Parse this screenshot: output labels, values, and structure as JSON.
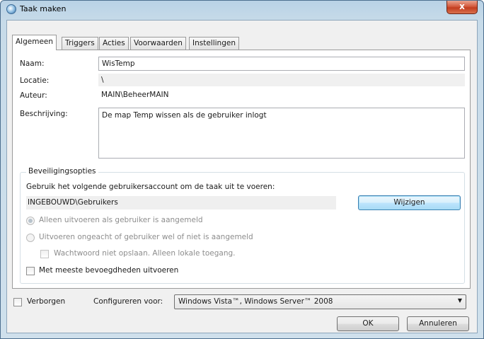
{
  "window": {
    "title": "Taak maken",
    "close_label": "x"
  },
  "tabs": [
    {
      "label": "Algemeen"
    },
    {
      "label": "Triggers"
    },
    {
      "label": "Acties"
    },
    {
      "label": "Voorwaarden"
    },
    {
      "label": "Instellingen"
    }
  ],
  "general": {
    "name_label": "Naam:",
    "name_value": "WisTemp",
    "location_label": "Locatie:",
    "location_value": "\\",
    "author_label": "Auteur:",
    "author_value": "MAIN\\BeheerMAIN",
    "description_label": "Beschrijving:",
    "description_value": "De map Temp wissen als de gebruiker inlogt"
  },
  "security": {
    "group_title": "Beveiligingsopties",
    "account_prompt": "Gebruik het volgende gebruikersaccount om de taak uit te voeren:",
    "account_value": "INGEBOUWD\\Gebruikers",
    "change_button": "Wijzigen",
    "radio_logged_on": "Alleen uitvoeren als gebruiker is aangemeld",
    "radio_whether": "Uitvoeren ongeacht of gebruiker wel of niet is aangemeld",
    "no_store_password": "Wachtwoord niet opslaan. Alleen lokale toegang.",
    "highest_privileges": "Met meeste bevoegdheden uitvoeren"
  },
  "footer": {
    "hidden_label": "Verborgen",
    "configure_label": "Configureren voor:",
    "configure_value": "Windows Vista™, Windows Server™ 2008",
    "ok_button": "OK",
    "cancel_button": "Annuleren"
  }
}
